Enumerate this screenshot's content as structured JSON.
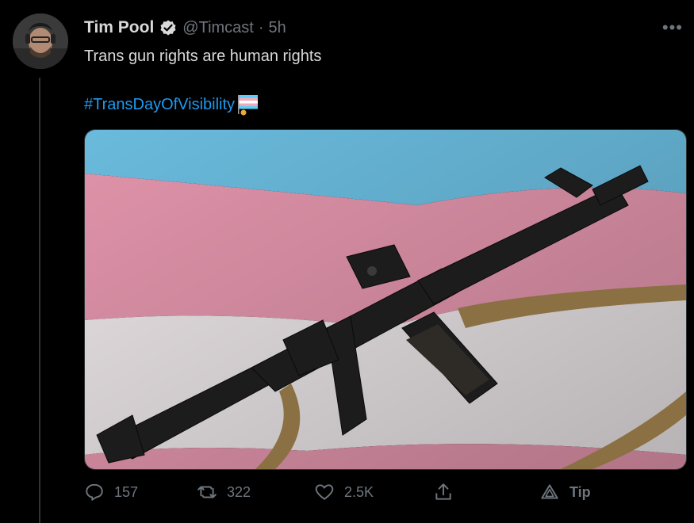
{
  "tweet": {
    "author_name": "Tim Pool",
    "handle": "@Timcast",
    "separator": "·",
    "time": "5h",
    "text": "Trans gun rights are human rights",
    "hashtag": "#TransDayOfVisibility",
    "emoji": "transgender-flag-emoji",
    "more_label": "•••"
  },
  "media": {
    "description_icon": "rifle-on-transgender-flag-photo",
    "colors": {
      "blue": "#5bcefa",
      "pink": "#f5a9b8",
      "white": "#ffffff"
    }
  },
  "actions": {
    "reply_count": "157",
    "retweet_count": "322",
    "like_count": "2.5K",
    "tip_label": "Tip"
  },
  "colors": {
    "background": "#000000",
    "text": "#d9d9d9",
    "muted": "#6e767d",
    "link": "#1d9bf0"
  }
}
